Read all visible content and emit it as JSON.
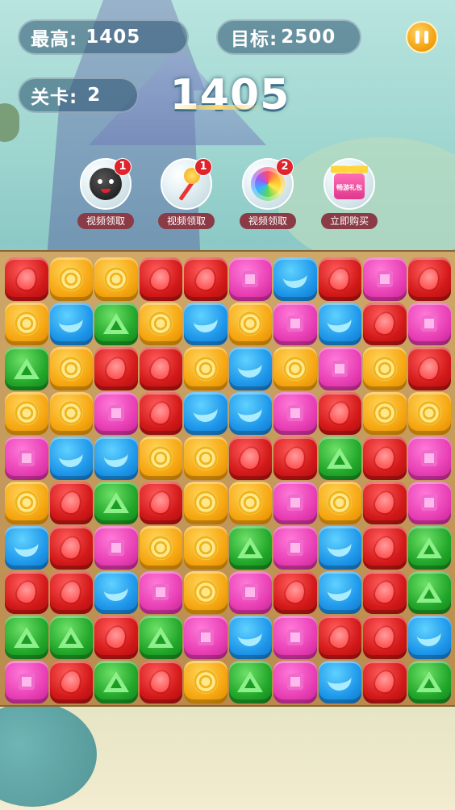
{
  "hud": {
    "best_label": "最高:",
    "best_value": "1405",
    "target_label": "目标:",
    "target_value": "2500",
    "level_label": "关卡:",
    "level_value": "2",
    "score": "1405"
  },
  "boosters": [
    {
      "name": "bomb",
      "label": "视频领取",
      "count": "1"
    },
    {
      "name": "hammer",
      "label": "视频领取",
      "count": "1"
    },
    {
      "name": "lollipop",
      "label": "视频领取",
      "count": "2"
    },
    {
      "name": "gift",
      "label": "立即购买",
      "count": "",
      "gift_text": "畅游礼包"
    }
  ],
  "board": {
    "rows": 10,
    "cols": 10,
    "tiles": [
      [
        "red",
        "orange",
        "orange",
        "red",
        "red",
        "pink",
        "blue",
        "red",
        "pink",
        "red"
      ],
      [
        "orange",
        "blue",
        "green",
        "orange",
        "blue",
        "orange",
        "pink",
        "blue",
        "red",
        "pink"
      ],
      [
        "green",
        "orange",
        "red",
        "red",
        "orange",
        "blue",
        "orange",
        "pink",
        "orange",
        "red"
      ],
      [
        "orange",
        "orange",
        "pink",
        "red",
        "blue",
        "blue",
        "pink",
        "red",
        "orange",
        "orange"
      ],
      [
        "pink",
        "blue",
        "blue",
        "orange",
        "orange",
        "red",
        "red",
        "green",
        "red",
        "pink"
      ],
      [
        "orange",
        "red",
        "green",
        "red",
        "orange",
        "orange",
        "pink",
        "orange",
        "red",
        "pink"
      ],
      [
        "blue",
        "red",
        "pink",
        "orange",
        "orange",
        "green",
        "pink",
        "blue",
        "red",
        "green"
      ],
      [
        "red",
        "red",
        "blue",
        "pink",
        "orange",
        "pink",
        "red",
        "blue",
        "red",
        "green"
      ],
      [
        "green",
        "green",
        "red",
        "green",
        "pink",
        "blue",
        "pink",
        "red",
        "red",
        "blue"
      ],
      [
        "pink",
        "red",
        "green",
        "red",
        "orange",
        "green",
        "pink",
        "blue",
        "red",
        "green"
      ]
    ]
  },
  "colors": {
    "red": "#d31919",
    "orange": "#f6a712",
    "blue": "#1f97ea",
    "green": "#22a72a",
    "pink": "#e83fb4"
  }
}
